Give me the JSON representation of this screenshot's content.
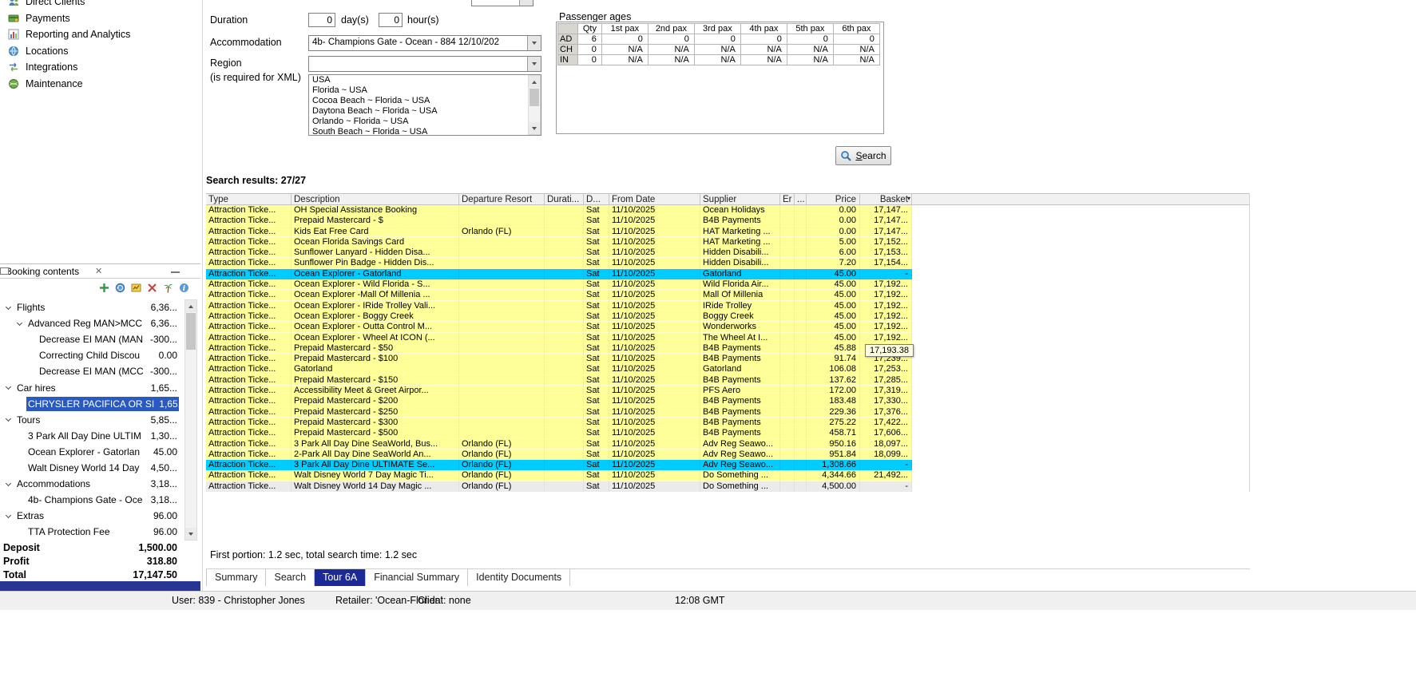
{
  "colors": {
    "row_yellow": "#ffff99",
    "row_cyan": "#00ccff",
    "row_gray": "#ebebeb",
    "selection_blue": "#2a5ac0",
    "tab_selected_bg": "#1b2a96",
    "panel_strip_blue": "#283593"
  },
  "sidebar": {
    "nav_items": [
      {
        "label": "Direct Clients",
        "icon": "direct-clients-icon"
      },
      {
        "label": "Payments",
        "icon": "payments-icon"
      },
      {
        "label": "Reporting and Analytics",
        "icon": "reporting-icon"
      },
      {
        "label": "Locations",
        "icon": "locations-icon"
      },
      {
        "label": "Integrations",
        "icon": "integrations-icon"
      },
      {
        "label": "Maintenance",
        "icon": "maintenance-icon"
      }
    ],
    "booking_panel": {
      "title": "Booking contents",
      "toolbar_icons": [
        "add-icon",
        "refresh-icon",
        "markup-icon",
        "delete-icon",
        "holiday-icon",
        "info-icon"
      ],
      "tree": [
        {
          "label": "Flights",
          "value": "6,36...",
          "indent": 0,
          "chevron": true
        },
        {
          "label": "Advanced Reg MAN>MCC",
          "value": "6,36...",
          "indent": 1,
          "chevron": true
        },
        {
          "label": "Decrease EI MAN (MAN",
          "value": "-300...",
          "indent": 2,
          "chevron": false
        },
        {
          "label": "Correcting Child Discou",
          "value": "0.00",
          "indent": 2,
          "chevron": false
        },
        {
          "label": "Decrease EI MAN (MCC",
          "value": "-300...",
          "indent": 2,
          "chevron": false
        },
        {
          "label": "Car hires",
          "value": "1,65...",
          "indent": 0,
          "chevron": true
        },
        {
          "label": "CHRYSLER PACIFICA OR SI",
          "value": "1,65...",
          "indent": 1,
          "chevron": false,
          "selected": true
        },
        {
          "label": "Tours",
          "value": "5,85...",
          "indent": 0,
          "chevron": true
        },
        {
          "label": "3 Park All Day Dine ULTIM",
          "value": "1,30...",
          "indent": 1,
          "chevron": false
        },
        {
          "label": "Ocean Explorer - Gatorlan",
          "value": "45.00",
          "indent": 1,
          "chevron": false
        },
        {
          "label": "Walt Disney World 14 Day",
          "value": "4,50...",
          "indent": 1,
          "chevron": false
        },
        {
          "label": "Accommodations",
          "value": "3,18...",
          "indent": 0,
          "chevron": true
        },
        {
          "label": "4b- Champions Gate - Oce",
          "value": "3,18...",
          "indent": 1,
          "chevron": false
        },
        {
          "label": "Extras",
          "value": "96.00",
          "indent": 0,
          "chevron": true
        },
        {
          "label": "TTA Protection Fee",
          "value": "96.00",
          "indent": 1,
          "chevron": false
        }
      ],
      "totals": [
        {
          "label": "Deposit",
          "value": "1,500.00"
        },
        {
          "label": "Profit",
          "value": "318.80"
        },
        {
          "label": "Total",
          "value": "17,147.50"
        }
      ]
    }
  },
  "search_form": {
    "duration_label": "Duration",
    "duration_days_value": "0",
    "duration_days_unit": "day(s)",
    "duration_hours_value": "0",
    "duration_hours_unit": "hour(s)",
    "accommodation_label": "Accommodation",
    "accommodation_value": "4b- Champions Gate - Ocean - 884 12/10/202",
    "region_label": "Region",
    "region_note": "(is required for XML)",
    "region_value": "",
    "region_options": [
      "USA",
      "Florida ~ USA",
      "Cocoa Beach ~ Florida ~ USA",
      "Daytona Beach ~ Florida ~ USA",
      "Orlando ~ Florida ~ USA",
      "South Beach ~ Florida ~ USA"
    ],
    "search_button_label": "Search"
  },
  "passenger_ages": {
    "title": "Passenger ages",
    "columns": [
      "Qty",
      "1st pax",
      "2nd pax",
      "3rd pax",
      "4th pax",
      "5th pax",
      "6th pax"
    ],
    "rows": [
      {
        "code": "AD",
        "cells": [
          "6",
          "0",
          "0",
          "0",
          "0",
          "0",
          "0"
        ]
      },
      {
        "code": "CH",
        "cells": [
          "0",
          "N/A",
          "N/A",
          "N/A",
          "N/A",
          "N/A",
          "N/A"
        ]
      },
      {
        "code": "IN",
        "cells": [
          "0",
          "N/A",
          "N/A",
          "N/A",
          "N/A",
          "N/A",
          "N/A"
        ]
      }
    ]
  },
  "results": {
    "summary": "Search results: 27/27",
    "columns": [
      "Type",
      "Description",
      "Departure Resort",
      "Durati...",
      "D...",
      "From Date",
      "Supplier",
      "Er",
      "...",
      "Price",
      "Basket"
    ],
    "sort_column": "Basket",
    "tooltip": "17,193.38",
    "timing_status": "First portion: 1.2 sec, total search time: 1.2 sec",
    "rows": [
      {
        "type": "Attraction Ticke...",
        "description": "OH Special Assistance Booking",
        "resort": "",
        "day": "Sat",
        "date": "11/10/2025",
        "supplier": "Ocean Holidays",
        "price": "0.00",
        "basket": "17,147...",
        "highlight": "yellow"
      },
      {
        "type": "Attraction Ticke...",
        "description": "Prepaid Mastercard - $",
        "resort": "",
        "day": "Sat",
        "date": "11/10/2025",
        "supplier": "B4B Payments",
        "price": "0.00",
        "basket": "17,147...",
        "highlight": "yellow"
      },
      {
        "type": "Attraction Ticke...",
        "description": "Kids Eat Free Card",
        "resort": "Orlando (FL)",
        "day": "Sat",
        "date": "11/10/2025",
        "supplier": "HAT Marketing ...",
        "price": "0.00",
        "basket": "17,147...",
        "highlight": "yellow"
      },
      {
        "type": "Attraction Ticke...",
        "description": "Ocean Florida Savings Card",
        "resort": "",
        "day": "Sat",
        "date": "11/10/2025",
        "supplier": "HAT Marketing ...",
        "price": "5.00",
        "basket": "17,152...",
        "highlight": "yellow"
      },
      {
        "type": "Attraction Ticke...",
        "description": "Sunflower Lanyard - Hidden Disa...",
        "resort": "",
        "day": "Sat",
        "date": "11/10/2025",
        "supplier": "Hidden Disabili...",
        "price": "6.00",
        "basket": "17,153...",
        "highlight": "yellow"
      },
      {
        "type": "Attraction Ticke...",
        "description": "Sunflower Pin Badge - Hidden Dis...",
        "resort": "",
        "day": "Sat",
        "date": "11/10/2025",
        "supplier": "Hidden Disabili...",
        "price": "7.20",
        "basket": "17,154...",
        "highlight": "yellow"
      },
      {
        "type": "Attraction Ticke...",
        "description": "Ocean Explorer - Gatorland",
        "resort": "",
        "day": "Sat",
        "date": "11/10/2025",
        "supplier": "Gatorland",
        "price": "45.00",
        "basket": "-",
        "highlight": "cyan"
      },
      {
        "type": "Attraction Ticke...",
        "description": "Ocean Explorer - Wild Florida - S...",
        "resort": "",
        "day": "Sat",
        "date": "11/10/2025",
        "supplier": "Wild Florida Air...",
        "price": "45.00",
        "basket": "17,192...",
        "highlight": "yellow"
      },
      {
        "type": "Attraction Ticke...",
        "description": "Ocean Explorer -Mall Of Millenia ...",
        "resort": "",
        "day": "Sat",
        "date": "11/10/2025",
        "supplier": "Mall Of Millenia",
        "price": "45.00",
        "basket": "17,192...",
        "highlight": "yellow"
      },
      {
        "type": "Attraction Ticke...",
        "description": "Ocean Explorer - IRide Trolley Vali...",
        "resort": "",
        "day": "Sat",
        "date": "11/10/2025",
        "supplier": "IRide Trolley",
        "price": "45.00",
        "basket": "17,192...",
        "highlight": "yellow"
      },
      {
        "type": "Attraction Ticke...",
        "description": "Ocean Explorer - Boggy Creek",
        "resort": "",
        "day": "Sat",
        "date": "11/10/2025",
        "supplier": "Boggy Creek",
        "price": "45.00",
        "basket": "17,192...",
        "highlight": "yellow"
      },
      {
        "type": "Attraction Ticke...",
        "description": "Ocean Explorer - Outta Control M...",
        "resort": "",
        "day": "Sat",
        "date": "11/10/2025",
        "supplier": "Wonderworks",
        "price": "45.00",
        "basket": "17,192...",
        "highlight": "yellow"
      },
      {
        "type": "Attraction Ticke...",
        "description": "Ocean Explorer - Wheel At ICON (...",
        "resort": "",
        "day": "Sat",
        "date": "11/10/2025",
        "supplier": "The Wheel At I...",
        "price": "45.00",
        "basket": "17,192...",
        "highlight": "yellow"
      },
      {
        "type": "Attraction Ticke...",
        "description": "Prepaid Mastercard - $50",
        "resort": "",
        "day": "Sat",
        "date": "11/10/2025",
        "supplier": "B4B Payments",
        "price": "45.88",
        "basket": "17,193...",
        "highlight": "yellow"
      },
      {
        "type": "Attraction Ticke...",
        "description": "Prepaid Mastercard - $100",
        "resort": "",
        "day": "Sat",
        "date": "11/10/2025",
        "supplier": "B4B Payments",
        "price": "91.74",
        "basket": "17,239...",
        "highlight": "yellow"
      },
      {
        "type": "Attraction Ticke...",
        "description": "Gatorland",
        "resort": "",
        "day": "Sat",
        "date": "11/10/2025",
        "supplier": "Gatorland",
        "price": "106.08",
        "basket": "17,253...",
        "highlight": "yellow"
      },
      {
        "type": "Attraction Ticke...",
        "description": "Prepaid Mastercard - $150",
        "resort": "",
        "day": "Sat",
        "date": "11/10/2025",
        "supplier": "B4B Payments",
        "price": "137.62",
        "basket": "17,285...",
        "highlight": "yellow"
      },
      {
        "type": "Attraction Ticke...",
        "description": "Accessibility Meet & Greet Airpor...",
        "resort": "",
        "day": "Sat",
        "date": "11/10/2025",
        "supplier": "PFS Aero",
        "price": "172.00",
        "basket": "17,319...",
        "highlight": "yellow"
      },
      {
        "type": "Attraction Ticke...",
        "description": "Prepaid Mastercard - $200",
        "resort": "",
        "day": "Sat",
        "date": "11/10/2025",
        "supplier": "B4B Payments",
        "price": "183.48",
        "basket": "17,330...",
        "highlight": "yellow"
      },
      {
        "type": "Attraction Ticke...",
        "description": "Prepaid Mastercard - $250",
        "resort": "",
        "day": "Sat",
        "date": "11/10/2025",
        "supplier": "B4B Payments",
        "price": "229.36",
        "basket": "17,376...",
        "highlight": "yellow"
      },
      {
        "type": "Attraction Ticke...",
        "description": "Prepaid Mastercard - $300",
        "resort": "",
        "day": "Sat",
        "date": "11/10/2025",
        "supplier": "B4B Payments",
        "price": "275.22",
        "basket": "17,422...",
        "highlight": "yellow"
      },
      {
        "type": "Attraction Ticke...",
        "description": "Prepaid Mastercard - $500",
        "resort": "",
        "day": "Sat",
        "date": "11/10/2025",
        "supplier": "B4B Payments",
        "price": "458.71",
        "basket": "17,606...",
        "highlight": "yellow"
      },
      {
        "type": "Attraction Ticke...",
        "description": "3 Park All Day Dine SeaWorld, Bus...",
        "resort": "Orlando (FL)",
        "day": "Sat",
        "date": "11/10/2025",
        "supplier": "Adv Reg Seawo...",
        "price": "950.16",
        "basket": "18,097...",
        "highlight": "yellow"
      },
      {
        "type": "Attraction Ticke...",
        "description": "2-Park All Day Dine SeaWorld An...",
        "resort": "Orlando (FL)",
        "day": "Sat",
        "date": "11/10/2025",
        "supplier": "Adv Reg Seawo...",
        "price": "951.84",
        "basket": "18,099...",
        "highlight": "yellow"
      },
      {
        "type": "Attraction Ticke...",
        "description": "3 Park All Day Dine ULTIMATE  Se...",
        "resort": "Orlando (FL)",
        "day": "Sat",
        "date": "11/10/2025",
        "supplier": "Adv Reg Seawo...",
        "price": "1,308.66",
        "basket": "-",
        "highlight": "cyan"
      },
      {
        "type": "Attraction Ticke...",
        "description": "Walt Disney World 7 Day Magic Ti...",
        "resort": "Orlando (FL)",
        "day": "Sat",
        "date": "11/10/2025",
        "supplier": "Do Something ...",
        "price": "4,344.66",
        "basket": "21,492...",
        "highlight": "yellow"
      },
      {
        "type": "Attraction Ticke...",
        "description": "Walt Disney World 14 Day Magic ...",
        "resort": "Orlando (FL)",
        "day": "Sat",
        "date": "11/10/2025",
        "supplier": "Do Something ...",
        "price": "4,500.00",
        "basket": "-",
        "highlight": "gray"
      }
    ]
  },
  "tabs": {
    "items": [
      "Summary",
      "Search",
      "Tour 6A",
      "Financial Summary",
      "Identity Documents"
    ],
    "selected": "Tour 6A"
  },
  "status_bar": {
    "user": "User: 839 - Christopher Jones",
    "retailer": "Retailer: 'Ocean-Florida'",
    "client": "Client: none",
    "time": "12:08 GMT"
  }
}
